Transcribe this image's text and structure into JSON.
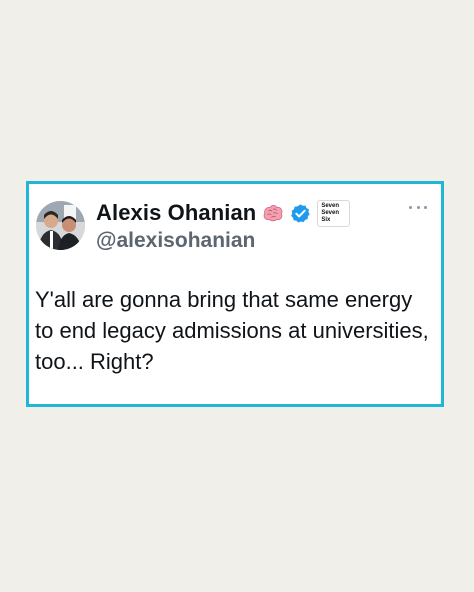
{
  "page": {
    "background_color": "#f1efe9"
  },
  "tweet": {
    "border_color": "#20b7d6",
    "author": {
      "display_name": "Alexis Ohanian",
      "handle": "@alexisohanian",
      "name_emoji": "brain-emoji",
      "verified": true,
      "verified_color": "#1d9bf0",
      "affiliate_badge_lines": [
        "Seven",
        "Seven",
        "Six"
      ]
    },
    "text": "Y'all are gonna bring that same energy to end legacy admissions at universities, too... Right?",
    "menu_icon": "more-horizontal-icon"
  }
}
